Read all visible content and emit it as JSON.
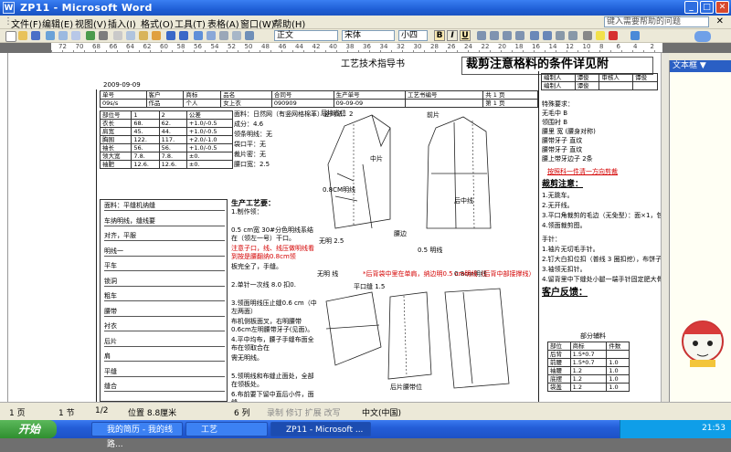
{
  "window": {
    "title": "ZP11 - Microsoft Word",
    "app_icon_letter": "W"
  },
  "menu": {
    "items": [
      "文件(F)",
      "编辑(E)",
      "视图(V)",
      "插入(I)",
      "格式(O)",
      "工具(T)",
      "表格(A)",
      "窗口(W)",
      "帮助(H)"
    ],
    "ask_placeholder": "键入需要帮助的问题"
  },
  "toolbar": {
    "style": "正文",
    "font": "宋体",
    "size": "小四",
    "bold": "B",
    "italic": "I",
    "underline": "U"
  },
  "ruler": {
    "numbers": [
      "72",
      "70",
      "68",
      "66",
      "64",
      "62",
      "60",
      "58",
      "56",
      "54",
      "52",
      "50",
      "48",
      "46",
      "44",
      "42",
      "40",
      "38",
      "36",
      "34",
      "32",
      "30",
      "28",
      "26",
      "24",
      "22",
      "20",
      "18",
      "16",
      "14",
      "12",
      "10",
      "8",
      "6",
      "4",
      "2"
    ]
  },
  "document": {
    "heading": "工艺技术指导书",
    "banner": "裁剪注意格料的条件详见附",
    "date": "2009-09-09",
    "info_headers": [
      "单号",
      "客户",
      "商标",
      "品名",
      "合同号",
      "生产单号",
      "工艺书编号",
      "共 1 页"
    ],
    "info_values": [
      "09s/s",
      "作品",
      "个人",
      "女上衣",
      "090909",
      "09-09-09",
      "",
      "第 1 页"
    ],
    "size_table": {
      "header": [
        "部位号",
        "1",
        "2",
        "公差"
      ],
      "rows": [
        [
          "衣长",
          "68.",
          "62.",
          "+1.0/-0.5"
        ],
        [
          "肩宽",
          "45.",
          "44.",
          "+1.0/-0.5"
        ],
        [
          "胸围",
          "122.",
          "117.",
          "+2.0/-1.0"
        ],
        [
          "袖长",
          "56.",
          "56.",
          "+1.0/-0.5"
        ],
        [
          "领大宽",
          "7.8.",
          "7.8.",
          "±0."
        ],
        [
          "袖肥",
          "12.6.",
          "12.6.",
          "±0."
        ]
      ]
    },
    "fabric_notes": [
      "面料：日然网（有竖网格棉革）竖网法：2",
      "成分：4.6",
      "领条明线：无",
      "袋口平：无",
      "裁片密：无",
      "腰口宽：2.5"
    ],
    "right_table": {
      "rows": [
        [
          "编制人",
          "谭俊",
          "审核人",
          "谭俊"
        ],
        [
          "编制人",
          "谭俊",
          "",
          ""
        ]
      ],
      "extra": "特殊要求："
    },
    "right_notes": [
      "无毛中 B",
      "领围衬 B",
      "腰里 宽 (腰身对称)",
      "腰带牙子 直纹",
      "腰带牙子 直纹",
      "腰上带牙边子 2条"
    ],
    "right_red": "按照科一件清一方向剪裁",
    "section_cut": "裁剪注意：",
    "cut_notes": [
      "1.无跳车。",
      "2.无开线。",
      "3.平口角裁剪的毛边（无免型）：面×1，包布×1。",
      "4.领面裁剪图。"
    ],
    "sew_notes": [
      "手针：",
      "1.袖片无切毛手针。",
      "2.钉大白扣位扣（普线 3 圈扣挖），布饼子，钉纽扣。",
      "3.袖领无扣针。",
      "4.留背里中下缝处小腿一端手针固定肥大骨针腰带长 0.5cm。"
    ],
    "customer_section": "客户反馈：",
    "left_process": [
      "面料：平缝机纳缝",
      "车纳明线，缝线要",
      "对齐，平服",
      "明线一",
      "平车",
      "锁洞",
      "粗车",
      "腰带",
      "衬衣",
      "后片",
      "肩",
      "平缝",
      "缝合"
    ],
    "process_title": "生产工艺要：",
    "process_steps": [
      "1.制作领：",
      "0.5 cm宽 30#分色明线系结在（领左一号）干口。",
      "注意子口，线、线压做明线看到按是腰翻纳0.8cm领",
      "板完全了，手缝。",
      "2.单针一次线 8.0 扣0.",
      "3.领面明线压止缝0.6 cm（中左两面）",
      "布机侧板面叉，右明腰带0.6cm左明腰带牙子(见面)。",
      "4.平中均布，腰子手缝布面全布在领取合在",
      "需无明线。",
      "5.领明线和布缝止面处，全部在领板处。",
      "6.布前要下留中直后小件，面缝。"
    ],
    "bottom_table": {
      "header": [
        "部位",
        "商标",
        "件数"
      ],
      "rows": [
        [
          "后背",
          "1.5*0.7",
          ""
        ],
        [
          "前腰",
          "1.5*0.7",
          "1.0"
        ],
        [
          "袖腰",
          "1.2",
          "1.0"
        ],
        [
          "底摆",
          "1.2",
          "1.0"
        ],
        [
          "袋盖",
          "1.2",
          "1.0"
        ]
      ],
      "title": "部分辅料"
    },
    "drawing_labels": [
      "后片省位",
      "前片",
      "中片",
      "0.8CM明线",
      "后中线",
      "无明 2.5",
      "腰边",
      "0.5 明线",
      "无明 线",
      "平口缝 1.5",
      "0.8cm明线",
      "后片腰带位"
    ],
    "annotation_red": "*后背袋中里在单肩，纳边明0.5 cm明线（后背中部接撑线）"
  },
  "taskpane": {
    "title": "文本框 ▼"
  },
  "status": {
    "page": "1 页",
    "section": "1 节",
    "pages": "1/2",
    "position": "位置 8.8厘米",
    "col": "6 列",
    "mode": "录制 修订 扩展 改写",
    "lang": "中文(中国)"
  },
  "taskbar": {
    "start": "开始",
    "tasks": [
      "我的简历 - 我的线路...",
      "工艺",
      "ZP11 - Microsoft ..."
    ],
    "time": "21:53"
  },
  "colors": {
    "titlebar": "#1f5fd6",
    "accent_red": "#d40000",
    "taskbar": "#245ed8"
  }
}
